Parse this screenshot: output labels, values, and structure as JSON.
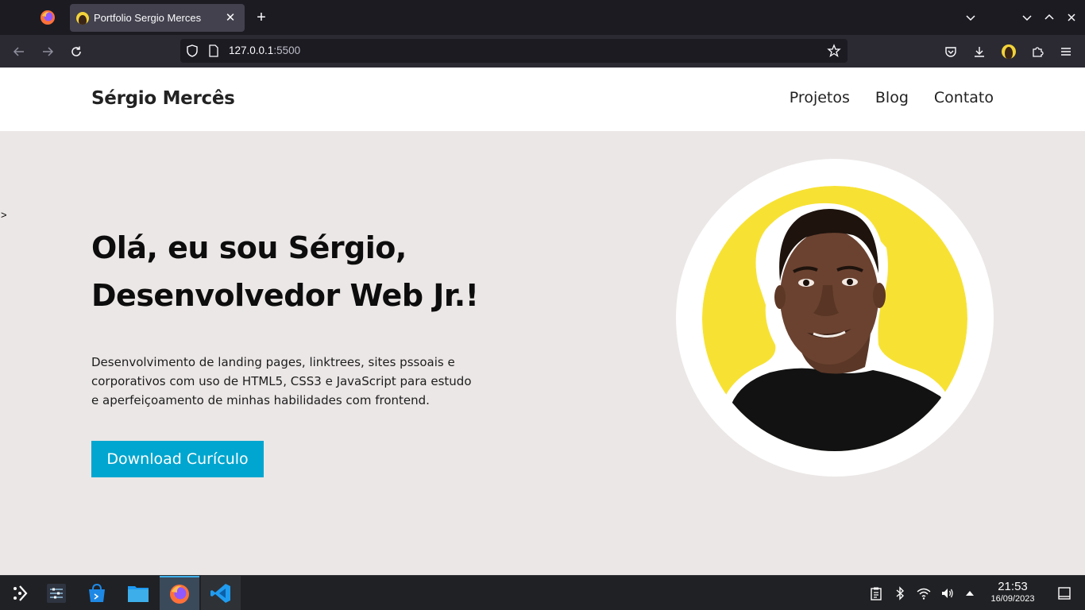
{
  "browser": {
    "tab_title": "Portfolio Sergio Merces",
    "url_host": "127.0.0.1",
    "url_port": ":5500"
  },
  "site": {
    "brand": "Sérgio Mercês",
    "nav": [
      "Projetos",
      "Blog",
      "Contato"
    ],
    "stray_text": ">",
    "hero": {
      "title_line1": "Olá, eu sou Sérgio,",
      "title_line2": "Desenvolvedor Web Jr.!",
      "description": "Desenvolvimento de landing pages, linktrees, sites pssoais e corporativos com uso de HTML5, CSS3 e JavaScript para estudo e aperfeiçoamento de minhas habilidades com frontend.",
      "cta_label": "Download Curículo"
    }
  },
  "taskbar": {
    "time": "21:53",
    "date": "16/09/2023"
  },
  "colors": {
    "accent": "#00a6cf",
    "page_bg": "#ebe7e6",
    "photo_bg": "#f7e234"
  }
}
